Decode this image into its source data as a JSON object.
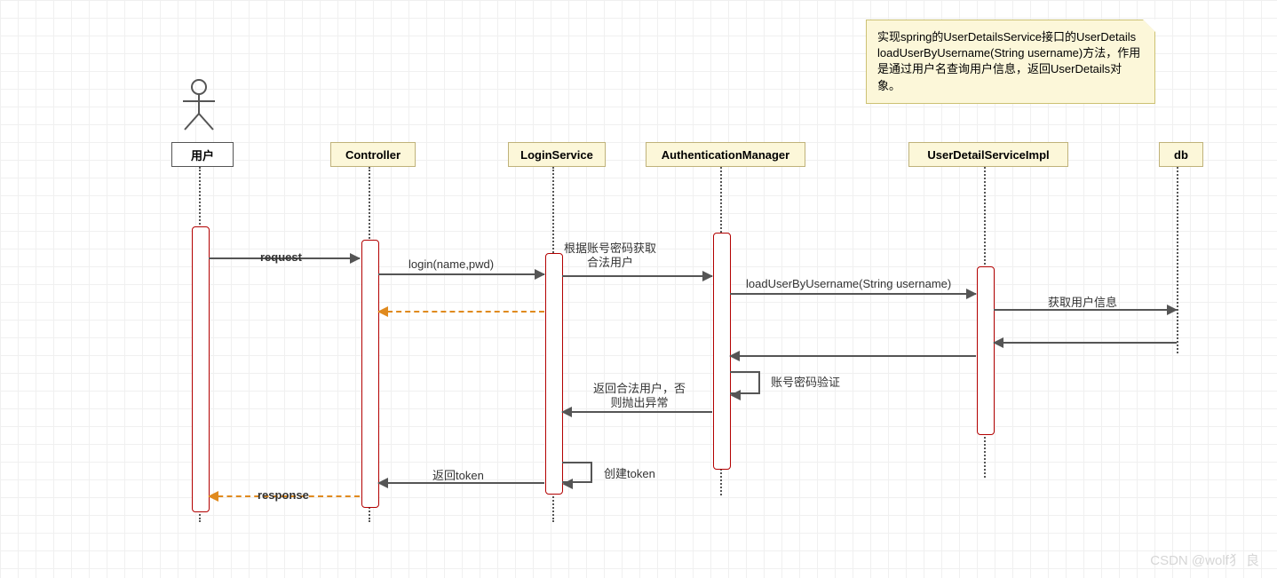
{
  "diagram": {
    "type": "sequence",
    "actors": [
      {
        "id": "user",
        "label": "用户",
        "kind": "actor"
      },
      {
        "id": "ctrl",
        "label": "Controller",
        "kind": "object"
      },
      {
        "id": "login",
        "label": "LoginService",
        "kind": "object"
      },
      {
        "id": "auth",
        "label": "AuthenticationManager",
        "kind": "object"
      },
      {
        "id": "udsvc",
        "label": "UserDetailServiceImpl",
        "kind": "object"
      },
      {
        "id": "db",
        "label": "db",
        "kind": "object"
      }
    ],
    "messages": {
      "m1": {
        "from": "user",
        "to": "ctrl",
        "label": "request",
        "style": "solid"
      },
      "m2": {
        "from": "ctrl",
        "to": "login",
        "label": "login(name,pwd)",
        "style": "solid"
      },
      "m3": {
        "from": "login",
        "to": "auth",
        "label": "根据账号密码获取合法用户",
        "style": "solid"
      },
      "m4": {
        "from": "auth",
        "to": "udsvc",
        "label": "loadUserByUsername(String username)",
        "style": "solid"
      },
      "m5": {
        "from": "udsvc",
        "to": "db",
        "label": "获取用户信息",
        "style": "solid"
      },
      "m6": {
        "from": "db",
        "to": "udsvc",
        "label": "",
        "style": "return"
      },
      "m7": {
        "from": "udsvc",
        "to": "auth",
        "label": "",
        "style": "return"
      },
      "m8": {
        "from": "auth",
        "to": "auth",
        "label": "账号密码验证",
        "style": "self"
      },
      "m9": {
        "from": "auth",
        "to": "login",
        "label": "返回合法用户，否则抛出异常",
        "style": "return"
      },
      "m10": {
        "from": "login",
        "to": "ctrl",
        "label": "",
        "style": "dashed"
      },
      "m11": {
        "from": "login",
        "to": "login",
        "label": "创建token",
        "style": "self"
      },
      "m12": {
        "from": "login",
        "to": "ctrl",
        "label": "返回token",
        "style": "return"
      },
      "m13": {
        "from": "ctrl",
        "to": "user",
        "label": "response",
        "style": "dashed"
      }
    },
    "note": {
      "text": "实现spring的UserDetailsService接口的UserDetails loadUserByUsername(String username)方法，作用是通过用户名查询用户信息，返回UserDetails对象。",
      "attached_to": "udsvc"
    },
    "watermark": "CSDN @wolf犭 良"
  }
}
